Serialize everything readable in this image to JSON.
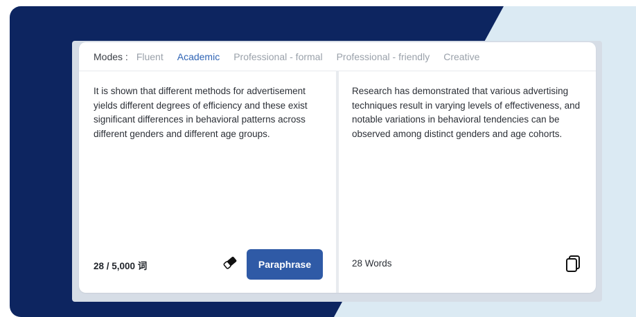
{
  "modes": {
    "label": "Modes :",
    "items": [
      {
        "label": "Fluent",
        "active": false
      },
      {
        "label": "Academic",
        "active": true
      },
      {
        "label": "Professional - formal",
        "active": false
      },
      {
        "label": "Professional - friendly",
        "active": false
      },
      {
        "label": "Creative",
        "active": false
      }
    ]
  },
  "input": {
    "text": "It is shown that different methods for advertisement yields different degrees of efficiency and these exist significant differences in behavioral patterns across different genders and different age groups.",
    "count": "28 / 5,000 词",
    "eraser_icon": "eraser-icon",
    "button_label": "Paraphrase"
  },
  "output": {
    "text": "Research has demonstrated that various advertising techniques result in varying levels of effectiveness, and notable variations in behavioral tendencies can be observed among distinct genders and age cohorts.",
    "count": "28 Words",
    "copy_icon": "copy-icon"
  },
  "colors": {
    "navy": "#0d2560",
    "light_panel": "#dbeaf3",
    "accent": "#2f64b5",
    "button": "#2f5aa6"
  }
}
